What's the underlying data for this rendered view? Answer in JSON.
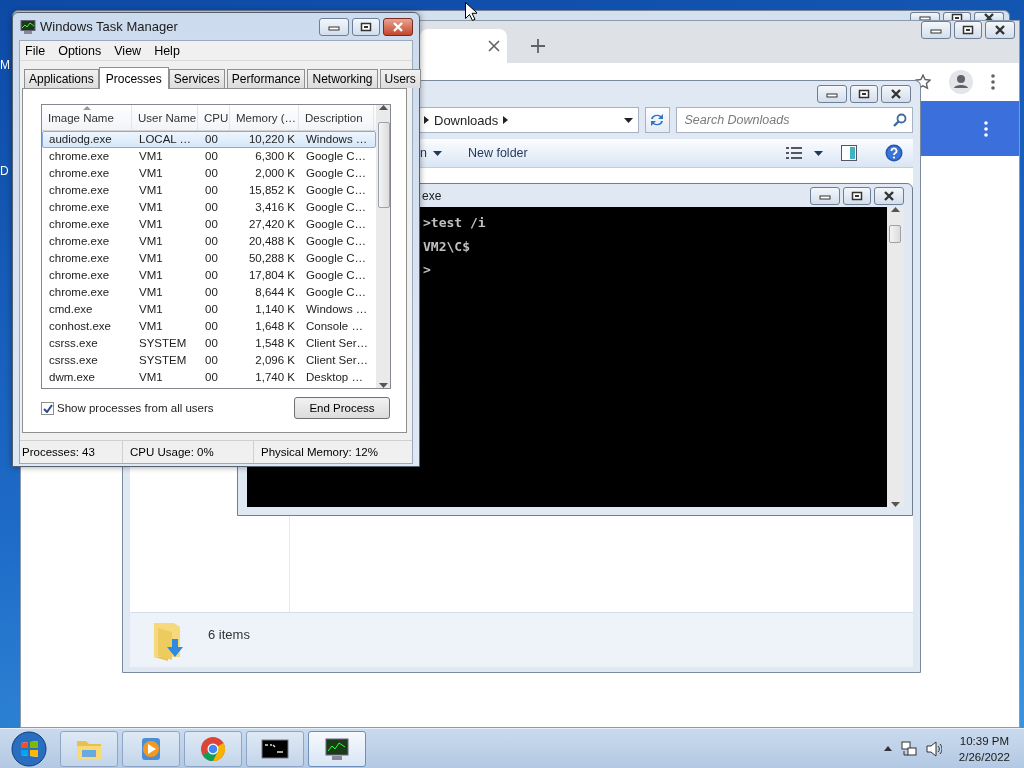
{
  "desktop": {
    "icon_labels": [
      "M",
      "D"
    ]
  },
  "explorer": {
    "breadcrumb": "Downloads",
    "search": {
      "placeholder": "Search Downloads"
    },
    "toolbar": [
      "n",
      "New folder"
    ],
    "status": "6 items"
  },
  "cmd": {
    "title": "exe",
    "lines": [
      ">test /i",
      "VM2\\C$",
      ">"
    ]
  },
  "task_manager": {
    "title": "Windows Task Manager",
    "menu": [
      "File",
      "Options",
      "View",
      "Help"
    ],
    "tabs": [
      {
        "label": "Applications",
        "selected": false
      },
      {
        "label": "Processes",
        "selected": true
      },
      {
        "label": "Services",
        "selected": false
      },
      {
        "label": "Performance",
        "selected": false
      },
      {
        "label": "Networking",
        "selected": false
      },
      {
        "label": "Users",
        "selected": false
      }
    ],
    "columns": [
      {
        "label": "Image Name",
        "sorted": true
      },
      {
        "label": "User Name",
        "sorted": false
      },
      {
        "label": "CPU",
        "sorted": false
      },
      {
        "label": "Memory (…",
        "sorted": false
      },
      {
        "label": "Description",
        "sorted": false
      }
    ],
    "rows": [
      {
        "cells": [
          "audiodg.exe",
          "LOCAL …",
          "00",
          "10,220 K",
          "Windows …"
        ],
        "selected": true
      },
      {
        "cells": [
          "chrome.exe",
          "VM1",
          "00",
          "6,300 K",
          "Google C…"
        ],
        "selected": false
      },
      {
        "cells": [
          "chrome.exe",
          "VM1",
          "00",
          "2,000 K",
          "Google C…"
        ],
        "selected": false
      },
      {
        "cells": [
          "chrome.exe",
          "VM1",
          "00",
          "15,852 K",
          "Google C…"
        ],
        "selected": false
      },
      {
        "cells": [
          "chrome.exe",
          "VM1",
          "00",
          "3,416 K",
          "Google C…"
        ],
        "selected": false
      },
      {
        "cells": [
          "chrome.exe",
          "VM1",
          "00",
          "27,420 K",
          "Google C…"
        ],
        "selected": false
      },
      {
        "cells": [
          "chrome.exe",
          "VM1",
          "00",
          "20,488 K",
          "Google C…"
        ],
        "selected": false
      },
      {
        "cells": [
          "chrome.exe",
          "VM1",
          "00",
          "50,288 K",
          "Google C…"
        ],
        "selected": false
      },
      {
        "cells": [
          "chrome.exe",
          "VM1",
          "00",
          "17,804 K",
          "Google C…"
        ],
        "selected": false
      },
      {
        "cells": [
          "chrome.exe",
          "VM1",
          "00",
          "8,644 K",
          "Google C…"
        ],
        "selected": false
      },
      {
        "cells": [
          "cmd.exe",
          "VM1",
          "00",
          "1,140 K",
          "Windows …"
        ],
        "selected": false
      },
      {
        "cells": [
          "conhost.exe",
          "VM1",
          "00",
          "1,648 K",
          "Console …"
        ],
        "selected": false
      },
      {
        "cells": [
          "csrss.exe",
          "SYSTEM",
          "00",
          "1,548 K",
          "Client Ser…"
        ],
        "selected": false
      },
      {
        "cells": [
          "csrss.exe",
          "SYSTEM",
          "00",
          "2,096 K",
          "Client Ser…"
        ],
        "selected": false
      },
      {
        "cells": [
          "dwm.exe",
          "VM1",
          "00",
          "1,740 K",
          "Desktop …"
        ],
        "selected": false
      }
    ],
    "show_all_users": {
      "label": "Show processes from all users",
      "checked": true
    },
    "end_button": "End Process",
    "status": [
      "Processes: 43",
      "CPU Usage: 0%",
      "Physical Memory: 12%"
    ]
  },
  "taskbar": {
    "buttons": [
      {
        "kind": "explorer",
        "selected": false
      },
      {
        "kind": "media",
        "selected": false
      },
      {
        "kind": "chrome",
        "selected": false
      },
      {
        "kind": "cmd",
        "selected": false
      },
      {
        "kind": "taskmgr",
        "selected": true
      }
    ],
    "clock": {
      "time": "10:39 PM",
      "date": "2/26/2022"
    }
  }
}
